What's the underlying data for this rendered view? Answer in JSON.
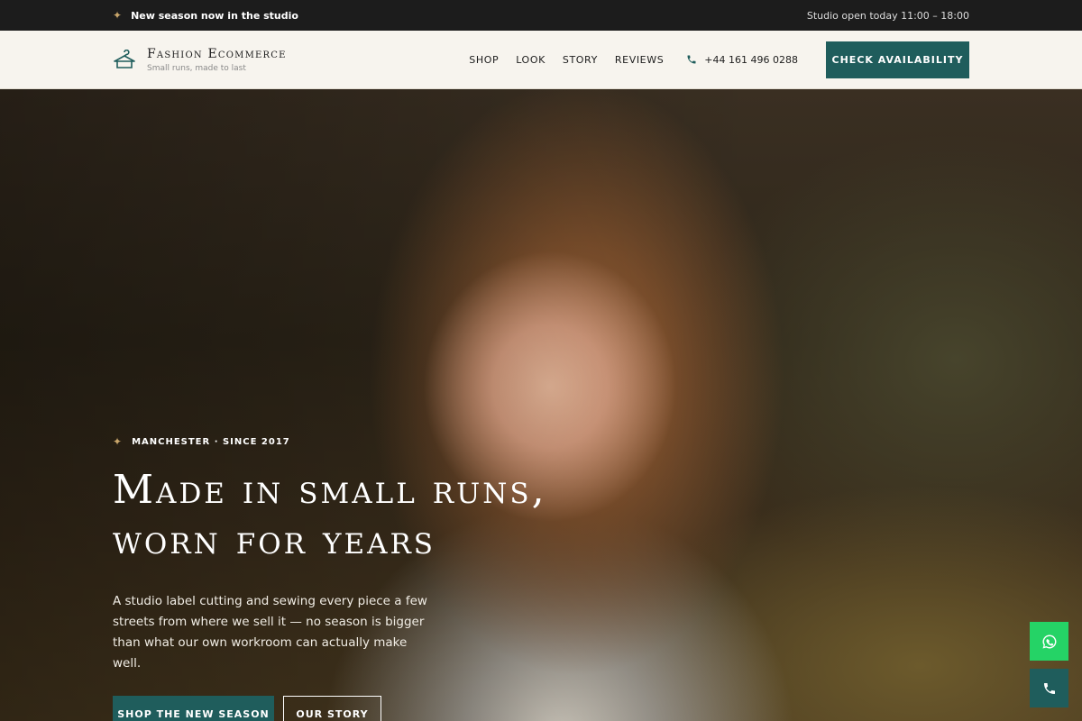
{
  "topbar": {
    "announcement": "New season now in the studio",
    "hours": "Studio open today 11:00 – 18:00",
    "sparkle_icon": "sparkle-icon"
  },
  "header": {
    "brand_name": "Fashion Ecommerce",
    "brand_tagline": "Small runs, made to last",
    "logo_icon": "hanger-icon",
    "nav": [
      {
        "label": "SHOP"
      },
      {
        "label": "LOOK"
      },
      {
        "label": "STORY"
      },
      {
        "label": "REVIEWS"
      }
    ],
    "phone": "+44 161 496 0288",
    "phone_icon": "phone-icon",
    "cta_label": "CHECK AVAILABILITY"
  },
  "hero": {
    "eyebrow": "MANCHESTER · SINCE 2017",
    "headline_line1": "Made in small runs,",
    "headline_line2": "worn for years",
    "subtext": "A studio label cutting and sewing every piece a few streets from where we sell it — no season is bigger than what our own workroom can actually make well.",
    "primary_button": "SHOP THE NEW SEASON",
    "secondary_button": "OUR STORY"
  },
  "floating": {
    "whatsapp_icon": "whatsapp-icon",
    "call_icon": "phone-icon"
  },
  "colors": {
    "accent": "#1f5d5c",
    "whatsapp": "#25d366",
    "topbar": "#1c1c1c",
    "header_bg": "#f7f4ee",
    "sparkle": "#c9a66b"
  }
}
